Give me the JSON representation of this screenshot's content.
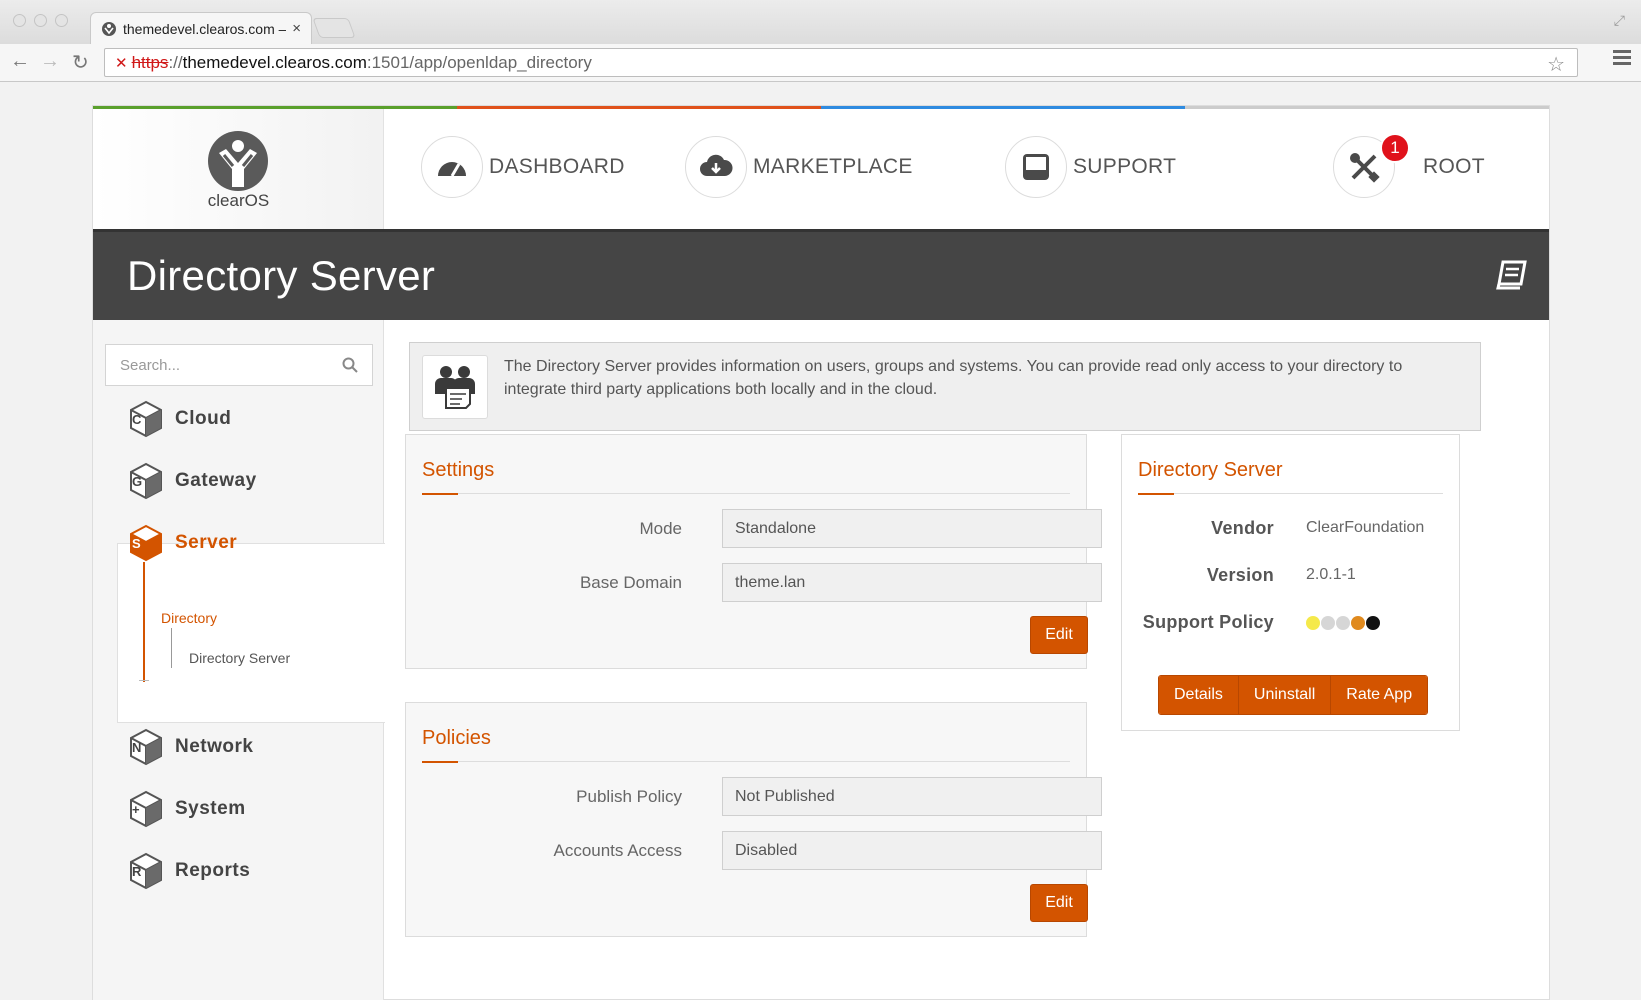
{
  "browser": {
    "tab_title": "themedevel.clearos.com –",
    "tab_close": "×",
    "url_scheme": "https",
    "url_sep": "://",
    "url_host": "themedevel.clearos.com",
    "url_path": ":1501/app/openldap_directory",
    "ssl_mark": "✕"
  },
  "brand": {
    "name": "clearOS"
  },
  "topnav": [
    {
      "label": "DASHBOARD",
      "icon": "gauge-icon"
    },
    {
      "label": "MARKETPLACE",
      "icon": "cloud-download-icon"
    },
    {
      "label": "SUPPORT",
      "icon": "inbox-icon"
    },
    {
      "label": "ROOT",
      "icon": "tools-icon",
      "badge": "1"
    }
  ],
  "page_title": "Directory Server",
  "sidebar": {
    "search_placeholder": "Search...",
    "categories": [
      {
        "label": "Cloud",
        "letter": "C"
      },
      {
        "label": "Gateway",
        "letter": "G"
      },
      {
        "label": "Server",
        "letter": "S"
      },
      {
        "label": "Network",
        "letter": "N"
      },
      {
        "label": "System",
        "letter": "+"
      },
      {
        "label": "Reports",
        "letter": "R"
      }
    ],
    "subcategory": "Directory",
    "app": "Directory Server"
  },
  "info": {
    "text": "The Directory Server provides information on users, groups and systems. You can provide read only access to your directory to integrate third party applications both locally and in the cloud."
  },
  "settings": {
    "title": "Settings",
    "mode_label": "Mode",
    "mode_value": "Standalone",
    "domain_label": "Base Domain",
    "domain_value": "theme.lan",
    "edit": "Edit"
  },
  "policies": {
    "title": "Policies",
    "publish_label": "Publish Policy",
    "publish_value": "Not Published",
    "access_label": "Accounts Access",
    "access_value": "Disabled",
    "edit": "Edit"
  },
  "app_info": {
    "title": "Directory Server",
    "vendor_label": "Vendor",
    "vendor_value": "ClearFoundation",
    "version_label": "Version",
    "version_value": "2.0.1-1",
    "support_label": "Support Policy",
    "support_dots": [
      "#f5e94a",
      "#d6d6d6",
      "#d6d6d6",
      "#e08a1e",
      "#111111"
    ],
    "buttons": [
      "Details",
      "Uninstall",
      "Rate App"
    ]
  },
  "colors": {
    "accent": "#d35400",
    "title_bar": "#454545",
    "color_bar": [
      "#5aa02c",
      "#e0521b",
      "#2f8be0",
      "#cccccc"
    ]
  }
}
